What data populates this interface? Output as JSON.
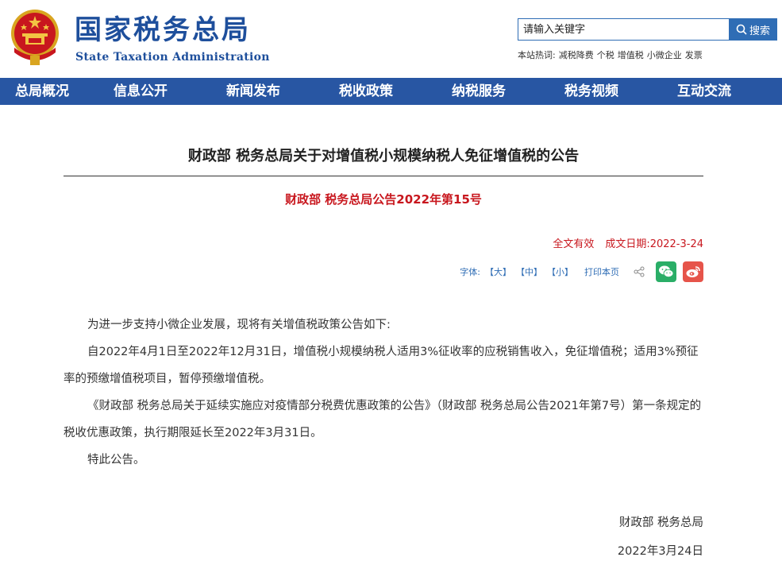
{
  "header": {
    "site_name_cn": "国家税务总局",
    "site_name_en": "State Taxation Administration",
    "search": {
      "placeholder": "请输入关键字",
      "button_label": "搜索"
    },
    "hot_label": "本站热词:",
    "hot_words": [
      "减税降费",
      "个税",
      "增值税",
      "小微企业",
      "发票"
    ]
  },
  "nav": {
    "items": [
      "总局概况",
      "信息公开",
      "新闻发布",
      "税收政策",
      "纳税服务",
      "税务视频",
      "互动交流"
    ]
  },
  "article": {
    "title": "财政部 税务总局关于对增值税小规模纳税人免征增值税的公告",
    "doc_number": "财政部 税务总局公告2022年第15号",
    "validity": "全文有效",
    "date_label": "成文日期:",
    "date": "2022-3-24",
    "font_label": "字体:",
    "font_sizes": [
      "【大】",
      "【中】",
      "【小】"
    ],
    "print_label": "打印本页",
    "paragraphs": [
      "为进一步支持小微企业发展，现将有关增值税政策公告如下:",
      "自2022年4月1日至2022年12月31日，增值税小规模纳税人适用3%征收率的应税销售收入，免征增值税；适用3%预征率的预缴增值税项目，暂停预缴增值税。",
      "《财政部 税务总局关于延续实施应对疫情部分税费优惠政策的公告》（财政部 税务总局公告2021年第7号）第一条规定的税收优惠政策，执行期限延长至2022年3月31日。",
      "特此公告。"
    ],
    "signature_org": "财政部 税务总局",
    "signature_date": "2022年3月24日"
  },
  "colors": {
    "brand_blue": "#1e4f9c",
    "nav_bg": "#2856a3",
    "accent_red": "#c8171e",
    "link_blue": "#2f6db5"
  },
  "icons": [
    "national-emblem-icon",
    "search-icon",
    "share-icon",
    "wechat-icon",
    "weibo-icon"
  ]
}
